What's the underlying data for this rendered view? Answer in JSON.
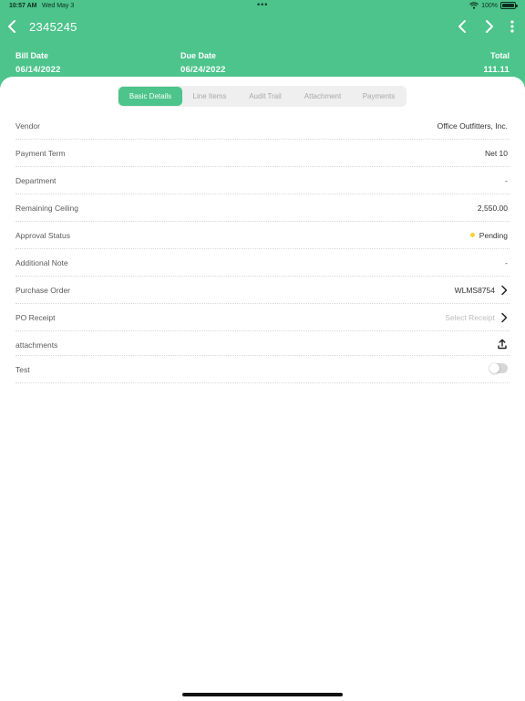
{
  "status_bar": {
    "time": "10:57 AM",
    "date": "Wed May 3",
    "multitask": "•••",
    "battery": "100%"
  },
  "nav": {
    "title": "2345245",
    "back_icon": "chevron-left-icon",
    "prev_icon": "chevron-left-icon",
    "next_icon": "chevron-right-icon",
    "more_icon": "more-vertical-icon"
  },
  "summary": {
    "bill_date_label": "Bill Date",
    "bill_date": "06/14/2022",
    "due_date_label": "Due Date",
    "due_date": "06/24/2022",
    "total_label": "Total",
    "total": "111.11"
  },
  "tabs": [
    {
      "label": "Basic Details",
      "active": true
    },
    {
      "label": "Line Items",
      "active": false
    },
    {
      "label": "Audit Trail",
      "active": false
    },
    {
      "label": "Attachment",
      "active": false
    },
    {
      "label": "Payments",
      "active": false
    }
  ],
  "details": {
    "vendor": {
      "label": "Vendor",
      "value": "Office Outfitters, Inc."
    },
    "payment_term": {
      "label": "Payment Term",
      "value": "Net 10"
    },
    "department": {
      "label": "Department",
      "value": "-"
    },
    "remaining_ceiling": {
      "label": "Remaining Ceiling",
      "value": "2,550.00"
    },
    "approval_status": {
      "label": "Approval Status",
      "value": "Pending",
      "status_color": "#f5d33a"
    },
    "additional_note": {
      "label": "Additional Note",
      "value": "-"
    },
    "purchase_order": {
      "label": "Purchase Order",
      "value": "WLMS8754"
    },
    "po_receipt": {
      "label": "PO Receipt",
      "placeholder": "Select Receipt"
    },
    "attachments": {
      "label": "attachments",
      "icon": "upload-icon"
    },
    "test": {
      "label": "Test",
      "toggle_on": false
    }
  },
  "colors": {
    "accent": "#4cc48b",
    "pending": "#f5d33a"
  }
}
